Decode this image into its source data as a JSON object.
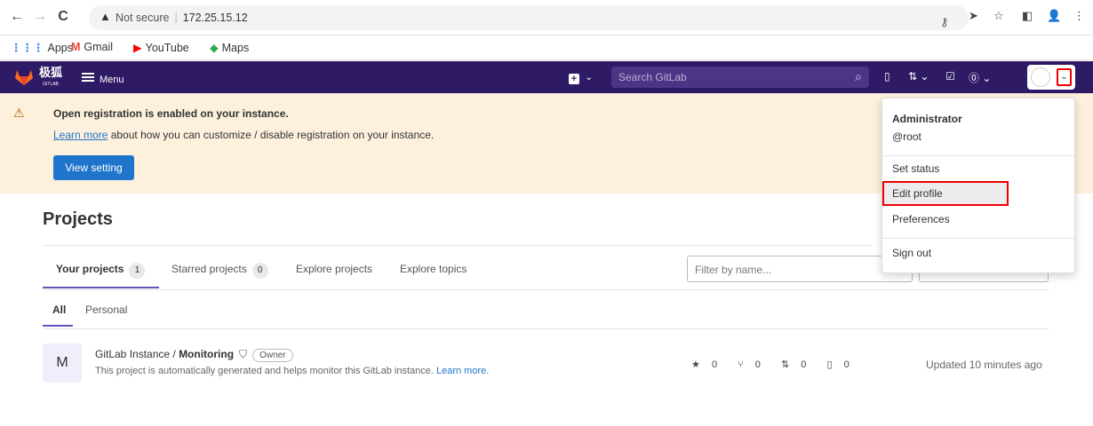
{
  "browser": {
    "url_security": "Not secure",
    "url": "172.25.15.12",
    "bookmarks": [
      "Apps",
      "Gmail",
      "YouTube",
      "Maps"
    ]
  },
  "topbar": {
    "brand": "极狐",
    "brand_sub": "GITLAB",
    "menu_label": "Menu",
    "search_placeholder": "Search GitLab"
  },
  "alert": {
    "title": "Open registration is enabled on your instance.",
    "link_text": "Learn more",
    "body": " about how you can customize / disable registration on your instance.",
    "button": "View setting"
  },
  "main": {
    "title": "Projects",
    "tabs": [
      {
        "label": "Your projects",
        "count": "1"
      },
      {
        "label": "Starred projects",
        "count": "0"
      },
      {
        "label": "Explore projects"
      },
      {
        "label": "Explore topics"
      }
    ],
    "filter_placeholder": "Filter by name...",
    "subtabs": [
      "All",
      "Personal"
    ]
  },
  "project": {
    "avatar_letter": "M",
    "namespace": "GitLab Instance / ",
    "name": "Monitoring",
    "role": "Owner",
    "description": "This project is automatically generated and helps monitor this GitLab instance. ",
    "learn_more": "Learn more.",
    "stars": "0",
    "forks": "0",
    "merge_requests": "0",
    "issues": "0",
    "updated": "Updated 10 minutes ago"
  },
  "dropdown": {
    "name": "Administrator",
    "username": "@root",
    "items": [
      "Set status",
      "Edit profile",
      "Preferences",
      "Sign out"
    ]
  }
}
